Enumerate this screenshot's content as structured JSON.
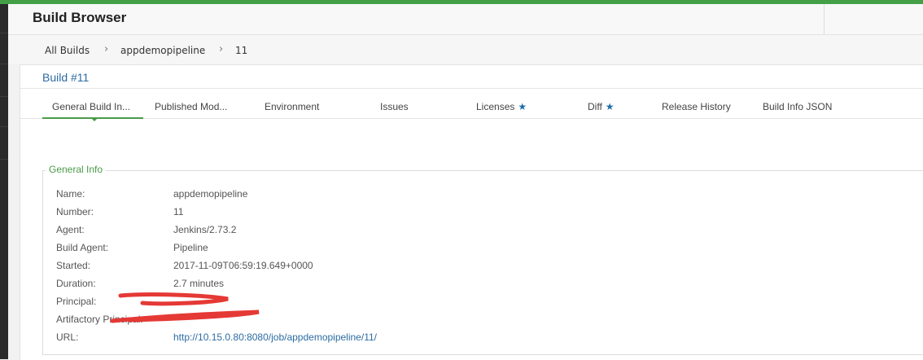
{
  "app": {
    "title": "Build Browser"
  },
  "breadcrumb": [
    {
      "label": "All Builds"
    },
    {
      "label": "appdemopipeline"
    },
    {
      "label": "11"
    }
  ],
  "build": {
    "title": "Build #11"
  },
  "tabs": [
    {
      "label": "General Build In...",
      "starred": false,
      "active": true
    },
    {
      "label": "Published Mod...",
      "starred": false,
      "active": false
    },
    {
      "label": "Environment",
      "starred": false,
      "active": false
    },
    {
      "label": "Issues",
      "starred": false,
      "active": false
    },
    {
      "label": "Licenses",
      "starred": true,
      "active": false
    },
    {
      "label": "Diff",
      "starred": true,
      "active": false
    },
    {
      "label": "Release History",
      "starred": false,
      "active": false
    },
    {
      "label": "Build Info JSON",
      "starred": false,
      "active": false
    }
  ],
  "general_info": {
    "legend": "General Info",
    "fields": [
      {
        "key": "Name:",
        "value": "appdemopipeline"
      },
      {
        "key": "Number:",
        "value": "11"
      },
      {
        "key": "Agent:",
        "value": "Jenkins/2.73.2"
      },
      {
        "key": "Build Agent:",
        "value": "Pipeline"
      },
      {
        "key": "Started:",
        "value": "2017-11-09T06:59:19.649+0000"
      },
      {
        "key": "Duration:",
        "value": "2.7 minutes"
      },
      {
        "key": "Principal:",
        "value": ""
      },
      {
        "key": "Artifactory Principal:",
        "value": ""
      },
      {
        "key": "URL:",
        "value": "http://10.15.0.80:8080/job/appdemopipeline/11/"
      }
    ]
  },
  "colors": {
    "accent_green": "#43a047",
    "link_blue": "#2c6ca3",
    "redaction_red": "#e53935"
  },
  "icons": {
    "star": "star-icon",
    "chevron": "chevron-right-icon"
  }
}
